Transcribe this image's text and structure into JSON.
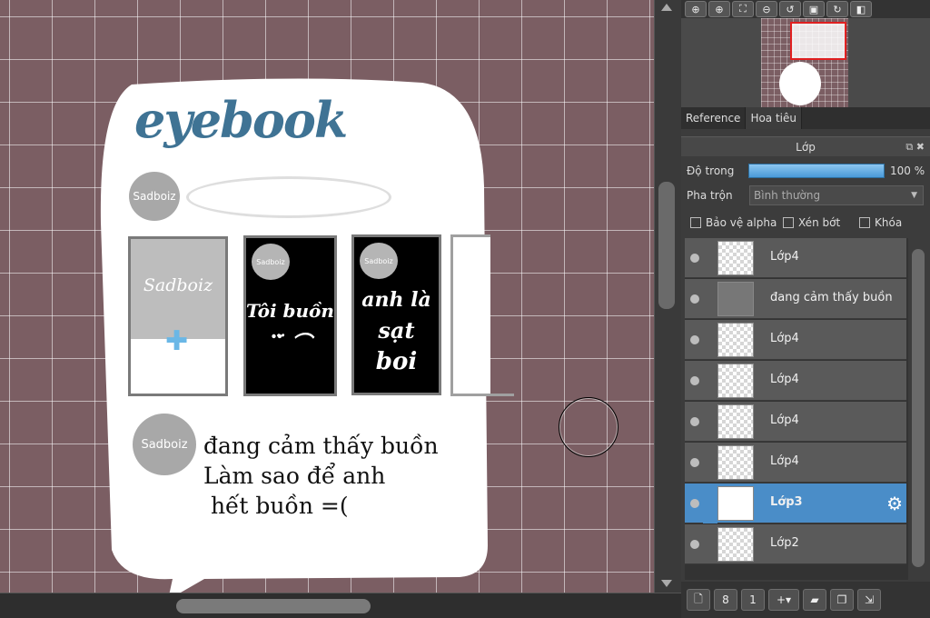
{
  "canvas": {
    "logo": "eyebook",
    "avatar_label": "Sadboiz",
    "stories": [
      {
        "label": "Sadboiz",
        "kind": "add-story"
      },
      {
        "label": "Sadboiz",
        "kind": "story",
        "text_lines": [
          "Tôi buồn",
          "⠉̈ ⌒"
        ]
      },
      {
        "label": "Sadboiz",
        "kind": "story",
        "text_lines": [
          "anh là",
          "sạt",
          "boi"
        ]
      }
    ],
    "post": {
      "avatar_label": "Sadboiz",
      "lines": [
        "đang cảm thấy buồn",
        "Làm sao để anh",
        " hết buồn =("
      ]
    }
  },
  "navigator": {
    "toolbar_icons": [
      "zoom-in-icon",
      "zoom-in-icon",
      "fit-icon",
      "zoom-out-icon",
      "rotate-left-icon",
      "fit-window-icon",
      "rotate-right-icon",
      "flip-icon"
    ],
    "tabs": [
      "Reference",
      "Hoa tiêu"
    ],
    "active_tab": "Hoa tiêu"
  },
  "layer_panel": {
    "title": "Lớp",
    "opacity_label": "Độ trong",
    "opacity_value": "100 %",
    "opacity_fraction": 1.0,
    "blend_label": "Pha trộn",
    "blend_value": "Bình thường",
    "checkboxes": [
      {
        "label": "Bảo vệ alpha",
        "checked": false
      },
      {
        "label": "Xén bớt",
        "checked": false
      },
      {
        "label": "Khóa",
        "checked": false
      }
    ],
    "layers": [
      {
        "name": "Lớp4",
        "selected": false
      },
      {
        "name": "đang cảm thấy buồn",
        "selected": false
      },
      {
        "name": "Lớp4",
        "selected": false
      },
      {
        "name": "Lớp4",
        "selected": false
      },
      {
        "name": "Lớp4",
        "selected": false
      },
      {
        "name": "Lớp4",
        "selected": false
      },
      {
        "name": "Lớp3",
        "selected": true
      },
      {
        "name": "Lớp2",
        "selected": false
      }
    ],
    "toolbar_icons": [
      "new-layer-icon",
      "new-color-layer-icon",
      "new-halftone-layer-icon",
      "add-layer-menu-icon",
      "new-folder-icon",
      "duplicate-layer-icon",
      "merge-layer-icon"
    ]
  },
  "colors": {
    "canvas_bg": "#7b5e63",
    "logo": "#3f7394",
    "selection": "#4a8dc8",
    "add_story_plus": "#6ab7e6"
  }
}
